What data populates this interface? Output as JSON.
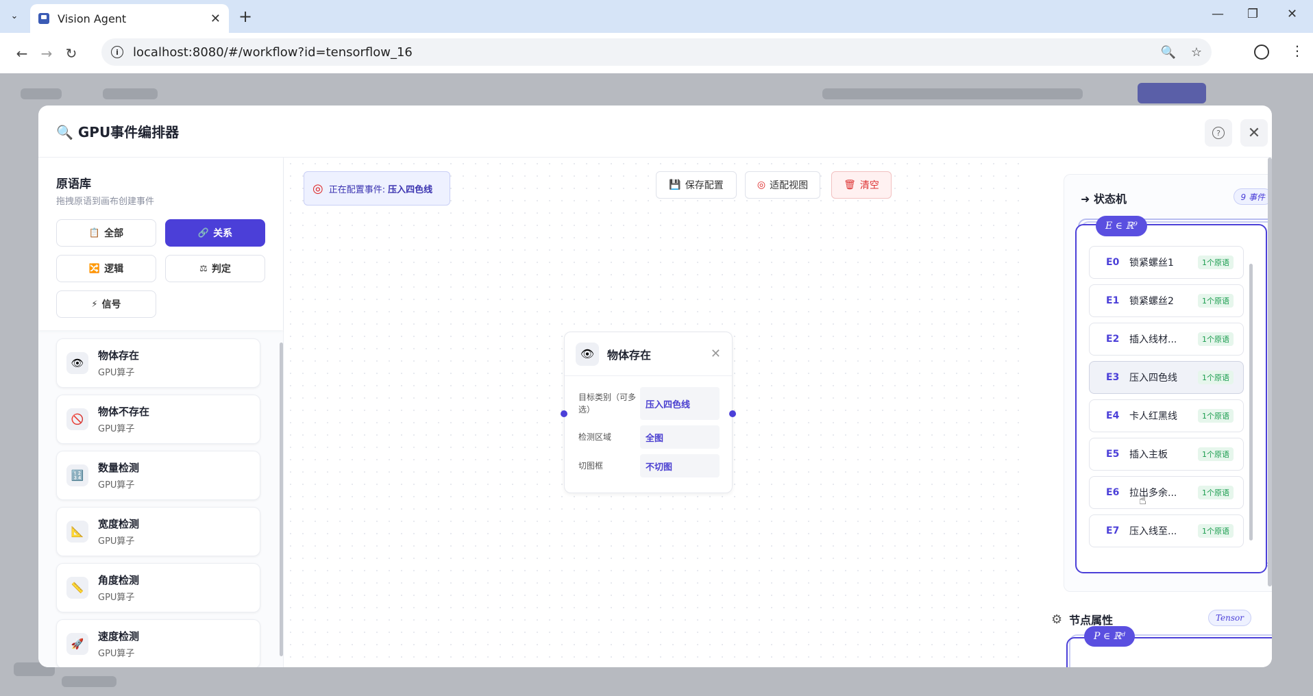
{
  "browser": {
    "tab_title": "Vision Agent",
    "url": "localhost:8080/#/workflow?id=tensorflow_16"
  },
  "modal": {
    "title": "🔍 GPU事件编排器"
  },
  "library": {
    "title": "原语库",
    "subtitle": "拖拽原语到画布创建事件",
    "categories": [
      {
        "label": "全部",
        "icon": "📋"
      },
      {
        "label": "关系",
        "icon": "🔗"
      },
      {
        "label": "逻辑",
        "icon": "🔀"
      },
      {
        "label": "判定",
        "icon": "⚖"
      },
      {
        "label": "信号",
        "icon": "⚡"
      }
    ],
    "primitives": [
      {
        "name": "物体存在",
        "sub": "GPU算子",
        "icon": "👁"
      },
      {
        "name": "物体不存在",
        "sub": "GPU算子",
        "icon": "🚫"
      },
      {
        "name": "数量检测",
        "sub": "GPU算子",
        "icon": "🔢"
      },
      {
        "name": "宽度检测",
        "sub": "GPU算子",
        "icon": "📐"
      },
      {
        "name": "角度检测",
        "sub": "GPU算子",
        "icon": "📏"
      },
      {
        "name": "速度检测",
        "sub": "GPU算子",
        "icon": "🚀"
      }
    ]
  },
  "canvas": {
    "config_label": "正在配置事件:",
    "config_event": "压入四色线",
    "tools": {
      "save": "保存配置",
      "fit": "适配视图",
      "clear": "清空"
    },
    "node": {
      "title": "物体存在",
      "rows": [
        {
          "key": "目标类别（可多选）",
          "value": "压入四色线"
        },
        {
          "key": "检测区域",
          "value": "全图"
        },
        {
          "key": "切图框",
          "value": "不切图"
        }
      ]
    }
  },
  "state_machine": {
    "title": "状态机",
    "badge": "9 事件",
    "math": "E ∈ ℝ⁹",
    "events": [
      {
        "id": "E0",
        "name": "锁紧螺丝1",
        "tag": "1个原语"
      },
      {
        "id": "E1",
        "name": "锁紧螺丝2",
        "tag": "1个原语"
      },
      {
        "id": "E2",
        "name": "插入线材...",
        "tag": "1个原语"
      },
      {
        "id": "E3",
        "name": "压入四色线",
        "tag": "1个原语"
      },
      {
        "id": "E4",
        "name": "卡人红黑线",
        "tag": "1个原语"
      },
      {
        "id": "E5",
        "name": "插入主板",
        "tag": "1个原语"
      },
      {
        "id": "E6",
        "name": "拉出多余...",
        "tag": "1个原语"
      },
      {
        "id": "E7",
        "name": "压入线至...",
        "tag": "1个原语"
      }
    ]
  },
  "node_props": {
    "title": "节点属性",
    "badge": "Tensor",
    "math": "P ∈ ℝᵈ"
  }
}
